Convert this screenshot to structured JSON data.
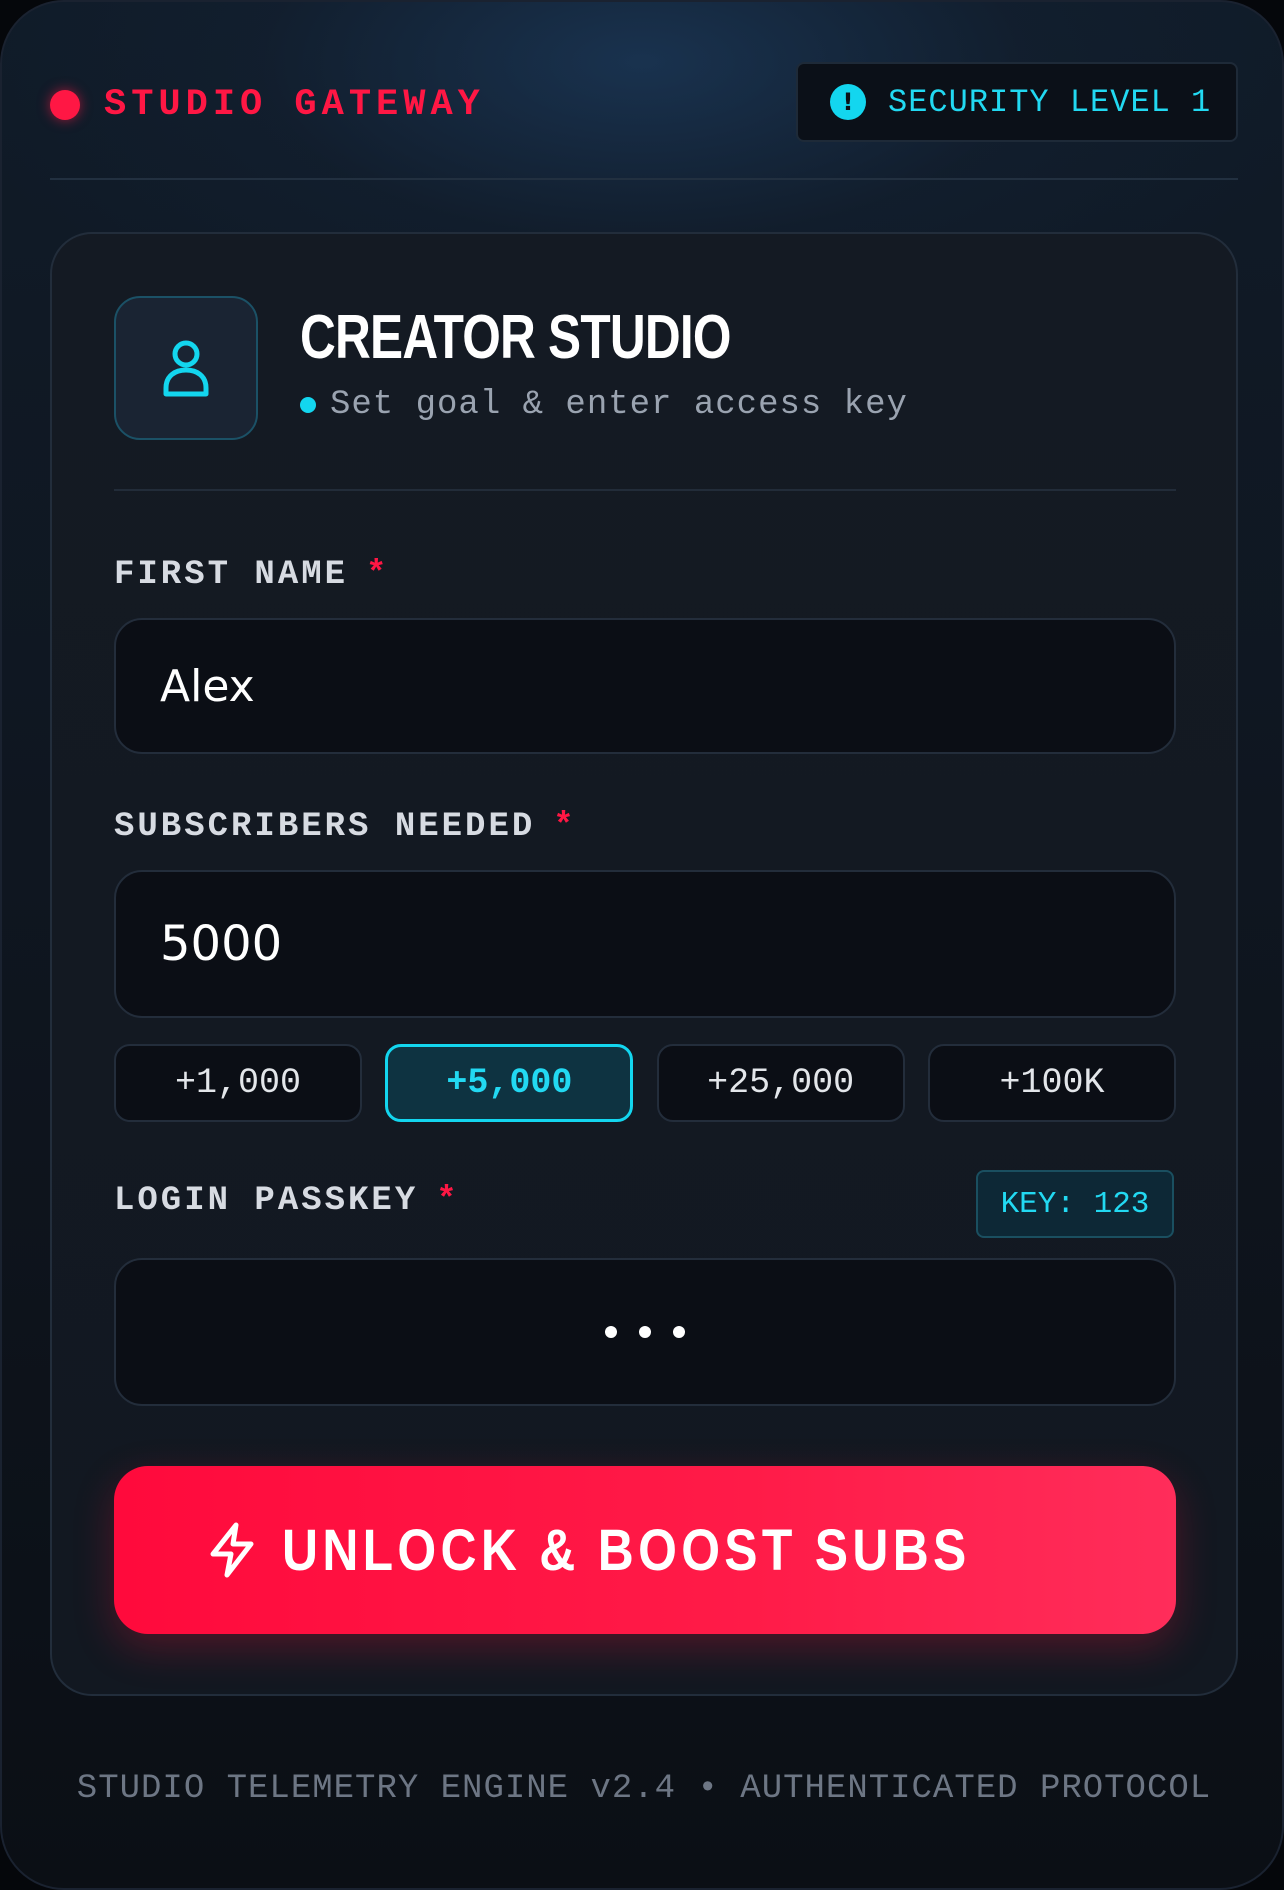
{
  "header": {
    "brand": "STUDIO GATEWAY",
    "security_badge": "SECURITY LEVEL 1",
    "security_icon": "alert-circle-icon"
  },
  "card": {
    "avatar_icon": "user-icon",
    "title": "CREATOR STUDIO",
    "subtitle": "Set goal & enter access key"
  },
  "form": {
    "first_name": {
      "label": "FIRST NAME",
      "required": "*",
      "value": "Alex"
    },
    "subscribers": {
      "label": "SUBSCRIBERS NEEDED",
      "required": "*",
      "value": "5000",
      "presets": [
        {
          "label": "+1,000",
          "selected": false
        },
        {
          "label": "+5,000",
          "selected": true
        },
        {
          "label": "+25,000",
          "selected": false
        },
        {
          "label": "+100K",
          "selected": false
        }
      ]
    },
    "passkey": {
      "label": "LOGIN PASSKEY",
      "required": "*",
      "hint": "KEY: 123",
      "masked_length": 3
    },
    "submit": {
      "label": "UNLOCK & BOOST SUBS",
      "icon": "lightning-bolt-icon"
    }
  },
  "footer": {
    "text": "STUDIO TELEMETRY ENGINE v2.4 • AUTHENTICATED PROTOCOL"
  },
  "colors": {
    "accent_red": "#ff1744",
    "accent_cyan": "#13d6ef",
    "background": "#0f1620"
  }
}
